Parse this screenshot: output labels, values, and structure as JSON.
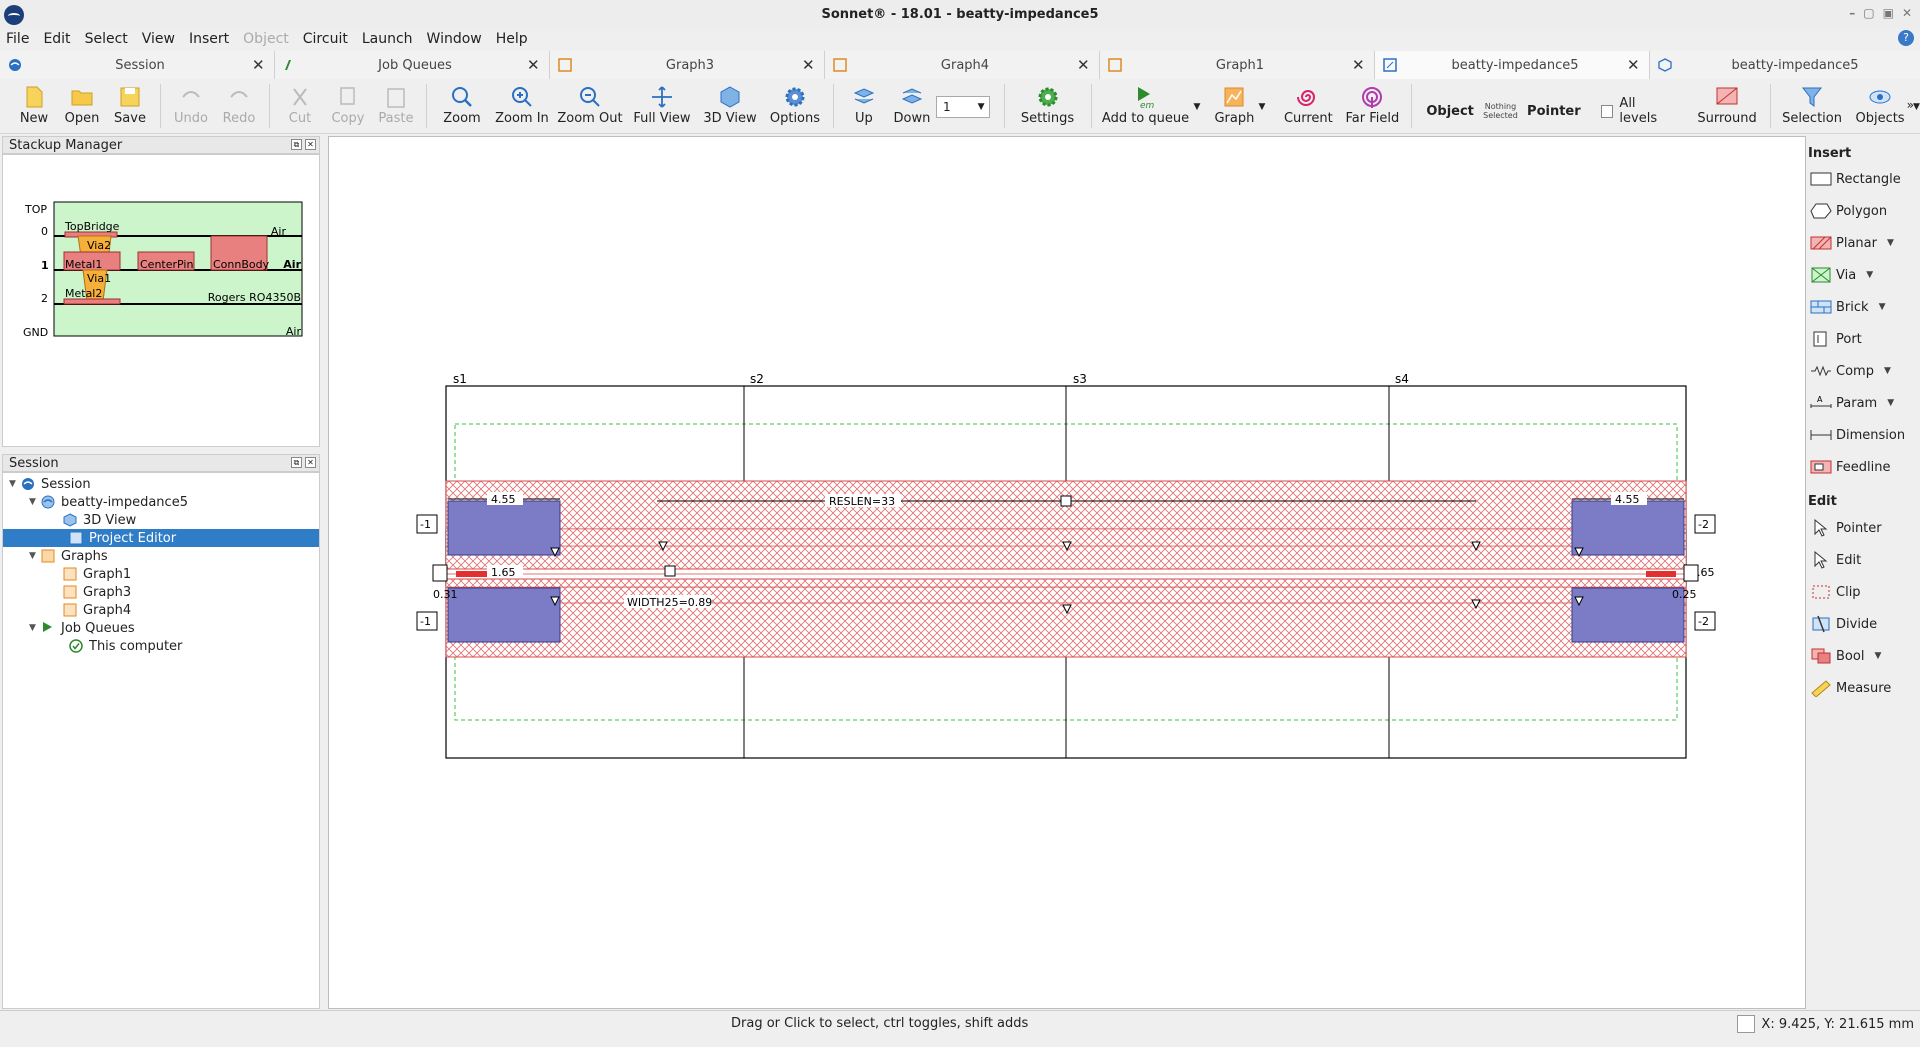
{
  "window": {
    "title": "Sonnet® - 18.01 - beatty-impedance5",
    "controls": [
      "–",
      "▢",
      "▣",
      "✕"
    ]
  },
  "menu": [
    "File",
    "Edit",
    "Select",
    "View",
    "Insert",
    "Object",
    "Circuit",
    "Launch",
    "Window",
    "Help"
  ],
  "menu_disabled": [
    "Object"
  ],
  "tabs": [
    {
      "label": "Session",
      "icon": "session-icon",
      "color": "#2b6fc2"
    },
    {
      "label": "Job Queues",
      "icon": "em-icon",
      "color": "#2d8a2d"
    },
    {
      "label": "Graph3",
      "icon": "graph-icon",
      "color": "#e08a24"
    },
    {
      "label": "Graph4",
      "icon": "graph-icon",
      "color": "#e08a24"
    },
    {
      "label": "Graph1",
      "icon": "graph-icon",
      "color": "#e08a24"
    },
    {
      "label": "beatty-impedance5",
      "icon": "project-editor-icon",
      "color": "#2b6fc2"
    },
    {
      "label": "beatty-impedance5",
      "icon": "3d-view-icon",
      "color": "#2b6fc2"
    }
  ],
  "toolbar": {
    "new": "New",
    "open": "Open",
    "save": "Save",
    "undo": "Undo",
    "redo": "Redo",
    "cut": "Cut",
    "copy": "Copy",
    "paste": "Paste",
    "zoom": "Zoom",
    "zoom_in": "Zoom In",
    "zoom_out": "Zoom Out",
    "full_view": "Full View",
    "view_3d": "3D View",
    "options": "Options",
    "up": "Up",
    "down": "Down",
    "level_value": "1",
    "settings": "Settings",
    "add_to_queue": "Add to queue",
    "graph": "Graph",
    "current": "Current",
    "far_field": "Far Field",
    "object": "Object",
    "nothing_selected": "Nothing Selected",
    "pointer": "Pointer",
    "all_levels": "All levels",
    "surround": "Surround",
    "selection": "Selection",
    "objects": "Objects"
  },
  "stackup": {
    "title": "Stackup Manager",
    "levels": [
      "TOP",
      "0",
      "1",
      "2",
      "GND"
    ],
    "labels": {
      "topbridge": "TopBridge",
      "via2": "Via2",
      "air0": "Air",
      "metal1": "Metal1",
      "centerpin": "CenterPin",
      "connbody": "ConnBody",
      "air1": "Air",
      "via1": "Via1",
      "metal2": "Metal2",
      "rogers": "Rogers RO4350B",
      "air_gnd": "Air"
    }
  },
  "session": {
    "title": "Session",
    "tree": [
      {
        "label": "Session",
        "depth": 0,
        "icon": "session-icon",
        "expanded": true
      },
      {
        "label": "beatty-impedance5",
        "depth": 1,
        "icon": "project-icon",
        "expanded": true
      },
      {
        "label": "3D View",
        "depth": 2,
        "icon": "3d-view-icon"
      },
      {
        "label": "Project Editor",
        "depth": 2,
        "icon": "project-editor-icon",
        "selected": true
      },
      {
        "label": "Graphs",
        "depth": 1,
        "icon": "graphs-folder-icon",
        "expanded": true
      },
      {
        "label": "Graph1",
        "depth": 2,
        "icon": "graph-icon"
      },
      {
        "label": "Graph3",
        "depth": 2,
        "icon": "graph-icon"
      },
      {
        "label": "Graph4",
        "depth": 2,
        "icon": "graph-icon"
      },
      {
        "label": "Job Queues",
        "depth": 1,
        "icon": "em-icon",
        "expanded": true
      },
      {
        "label": "This computer",
        "depth": 2,
        "icon": "check-icon"
      }
    ]
  },
  "layout_canvas": {
    "sections": [
      "s1",
      "s2",
      "s3",
      "s4"
    ],
    "dims": {
      "left_width": "4.55",
      "right_width": "4.55",
      "reslen": "RESLEN=33",
      "left_gap": "1.65",
      "right_gap": "1.65",
      "width25": "WIDTH25=0.89",
      "left_small": "0.31",
      "right_small": "0.25"
    },
    "ports": {
      "left_top": "-1",
      "left_bottom": "-1",
      "right_top": "-2",
      "right_bottom": "-2"
    },
    "colors": {
      "metal": "#d94a4a",
      "pad": "#7b7bc6",
      "box": "#3cc33c"
    }
  },
  "insert_panel": {
    "title": "Insert",
    "items": [
      "Rectangle",
      "Polygon",
      "Planar",
      "Via",
      "Brick",
      "Port",
      "Comp",
      "Param",
      "Dimension",
      "Feedline"
    ]
  },
  "edit_panel": {
    "title": "Edit",
    "items": [
      "Pointer",
      "Edit",
      "Clip",
      "Divide",
      "Bool",
      "Measure"
    ]
  },
  "status": {
    "message": "Drag or Click to select, ctrl toggles, shift adds",
    "coords": "X: 9.425, Y: 21.615 mm"
  }
}
